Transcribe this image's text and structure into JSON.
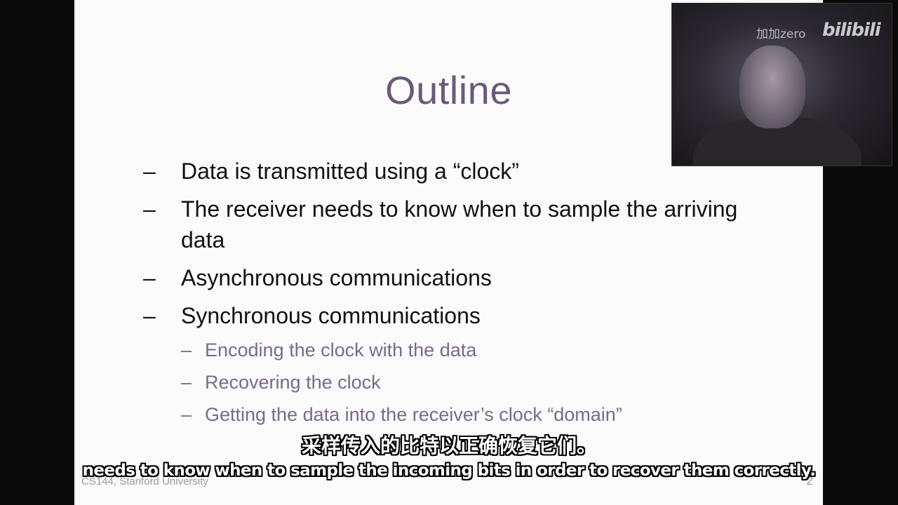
{
  "slide": {
    "title": "Outline",
    "bullets": [
      {
        "dash": "–",
        "text": "Data is transmitted using a “clock”"
      },
      {
        "dash": "–",
        "text": "The receiver needs to know when to sample the arriving data"
      },
      {
        "dash": "–",
        "text": "Asynchronous communications"
      },
      {
        "dash": "–",
        "text": "Synchronous communications"
      }
    ],
    "sub_bullets": [
      {
        "dash": "–",
        "text": "Encoding the clock with the data"
      },
      {
        "dash": "–",
        "text": "Recovering the clock"
      },
      {
        "dash": "–",
        "text": "Getting the data into the receiver’s clock “domain”"
      }
    ],
    "footer_left": "CS144, Stanford University",
    "page_number": "2"
  },
  "watermark": {
    "uploader": "加加zero",
    "brand": "bilibili"
  },
  "subtitles": {
    "chinese": "采样传入的比特以正确恢复它们。",
    "english": "needs to know when to sample the incoming bits in order to recover them correctly."
  },
  "colors": {
    "title": "#6b5a7a",
    "bullet": "#111111",
    "sub_bullet": "#7a6a88",
    "slide_bg": "#fbfbfb",
    "frame_bg": "#0a0a0a"
  }
}
